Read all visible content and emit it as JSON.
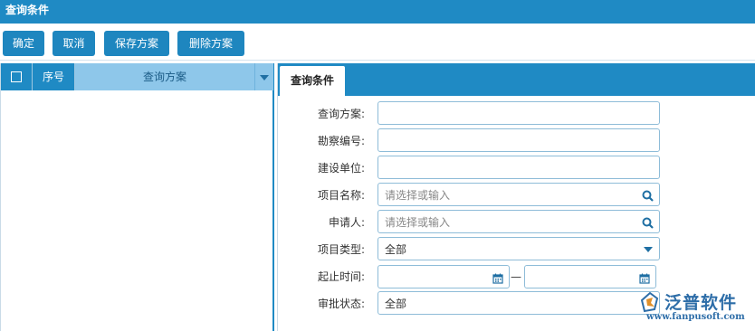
{
  "window": {
    "title": "查询条件"
  },
  "toolbar": {
    "confirm": "确定",
    "cancel": "取消",
    "save_plan": "保存方案",
    "delete_plan": "删除方案"
  },
  "grid": {
    "columns": {
      "seq": "序号",
      "plan": "查询方案"
    }
  },
  "tab": {
    "label": "查询条件"
  },
  "form": {
    "plan_label": "查询方案:",
    "survey_no_label": "勘察编号:",
    "build_unit_label": "建设单位:",
    "project_name_label": "项目名称:",
    "project_name_placeholder": "请选择或输入",
    "applicant_label": "申请人:",
    "applicant_placeholder": "请选择或输入",
    "project_type_label": "项目类型:",
    "project_type_value": "全部",
    "date_range_label": "起止时间:",
    "date_sep": "—",
    "approval_status_label": "审批状态:",
    "approval_status_value": "全部"
  },
  "logo": {
    "name": "泛普软件",
    "url": "www.fanpusoft.com"
  },
  "colors": {
    "primary": "#1f8ac4",
    "header_light": "#8ec7ea",
    "field_border": "#8ebcd8",
    "icon": "#1f6fa3"
  }
}
